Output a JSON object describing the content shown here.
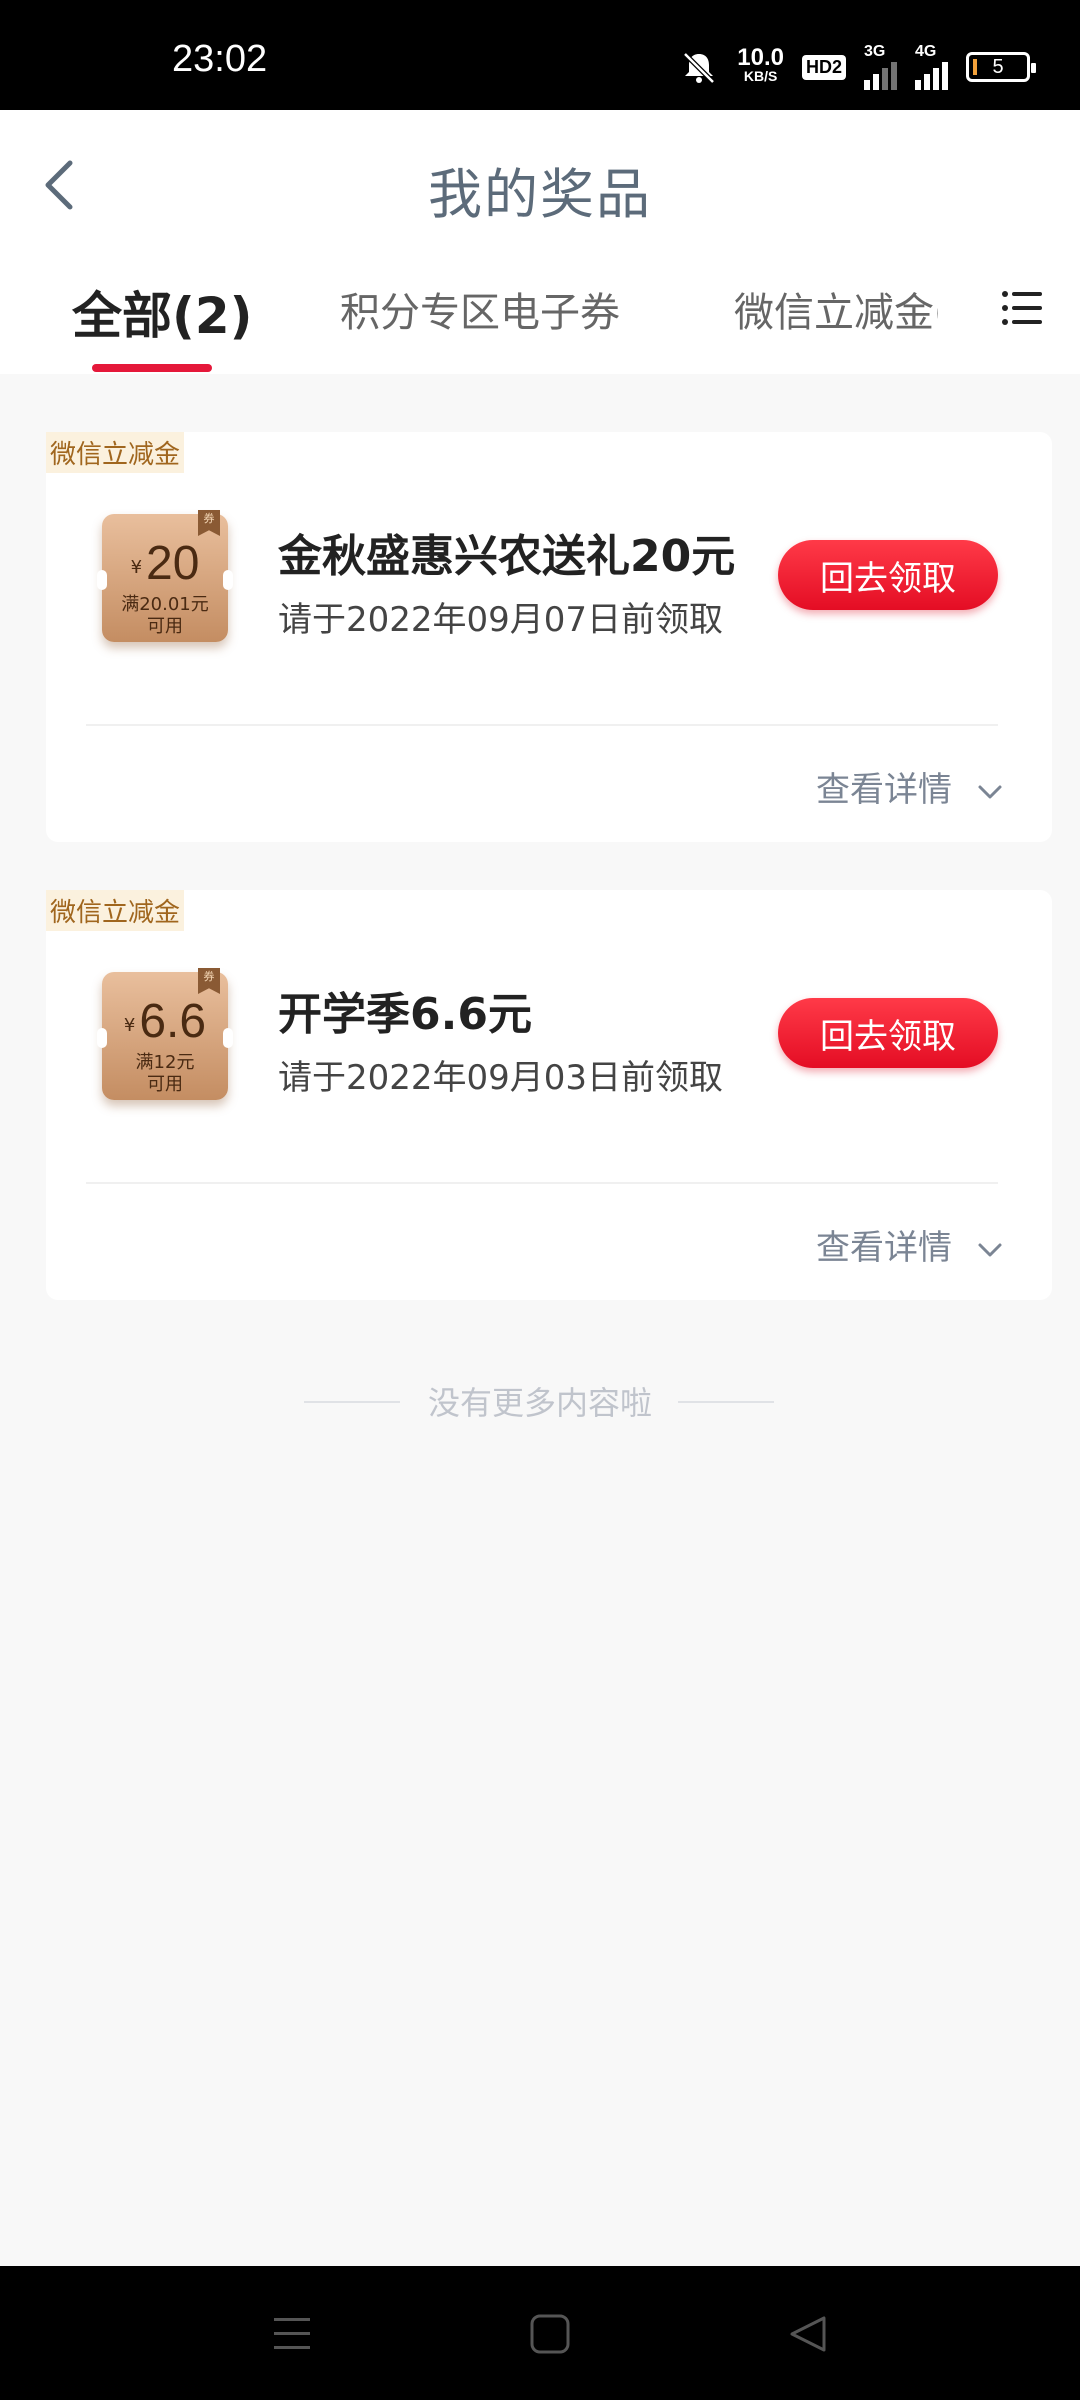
{
  "status_bar": {
    "time": "23:02",
    "net_speed_value": "10.0",
    "net_speed_unit": "KB/S",
    "hd_label": "HD2",
    "sim1_type": "3G",
    "sim2_type": "4G",
    "battery_level": "5"
  },
  "header": {
    "title": "我的奖品"
  },
  "tabs": [
    {
      "label": "全部(2)",
      "active": true
    },
    {
      "label": "积分专区电子券",
      "active": false
    },
    {
      "label": "微信立减金(",
      "active": false
    }
  ],
  "prizes": [
    {
      "tag": "微信立减金",
      "coupon_currency": "¥",
      "coupon_amount": "20",
      "coupon_condition_line1": "满20.01元",
      "coupon_condition_line2": "可用",
      "coupon_ribbon": "券",
      "name": "金秋盛惠兴农送礼20元",
      "deadline": "请于2022年09月07日前领取",
      "action_label": "回去领取",
      "details_label": "查看详情"
    },
    {
      "tag": "微信立减金",
      "coupon_currency": "¥",
      "coupon_amount": "6.6",
      "coupon_condition_line1": "满12元",
      "coupon_condition_line2": "可用",
      "coupon_ribbon": "券",
      "name": "开学季6.6元",
      "deadline": "请于2022年09月03日前领取",
      "action_label": "回去领取",
      "details_label": "查看详情"
    }
  ],
  "end_note": "没有更多内容啦",
  "colors": {
    "accent": "#e5183a",
    "coupon_gold": "#c48d62",
    "tag_text": "#a0661e"
  }
}
